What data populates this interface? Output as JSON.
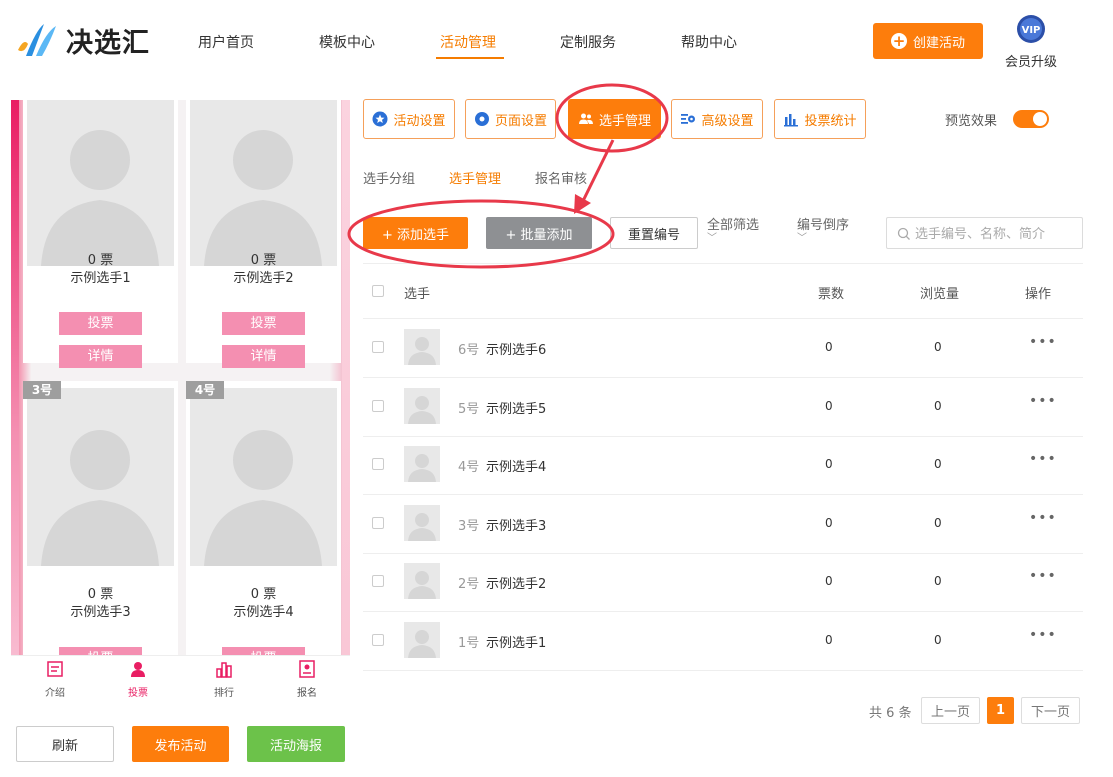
{
  "header": {
    "logo_text": "决选汇",
    "nav": [
      "用户首页",
      "模板中心",
      "活动管理",
      "定制服务",
      "帮助中心"
    ],
    "active_nav": "活动管理",
    "create_label": "创建活动",
    "vip_badge": "VIP",
    "vip_label": "会员升级"
  },
  "preview": {
    "cards": [
      {
        "number": "",
        "votes": "0 票",
        "name": "示例选手1",
        "vote_label": "投票",
        "detail_label": "详情"
      },
      {
        "number": "",
        "votes": "0 票",
        "name": "示例选手2",
        "vote_label": "投票",
        "detail_label": "详情"
      },
      {
        "number": "3号",
        "votes": "0 票",
        "name": "示例选手3",
        "vote_label": "投票"
      },
      {
        "number": "4号",
        "votes": "0 票",
        "name": "示例选手4",
        "vote_label": "投票"
      }
    ],
    "tabbar": [
      {
        "label": "介绍",
        "icon": "intro-icon"
      },
      {
        "label": "投票",
        "icon": "user-icon"
      },
      {
        "label": "排行",
        "icon": "ranking-icon"
      },
      {
        "label": "报名",
        "icon": "signup-icon"
      }
    ],
    "active_tab": "投票"
  },
  "bottom_buttons": {
    "refresh": "刷新",
    "publish": "发布活动",
    "poster": "活动海报"
  },
  "settings_tabs": [
    {
      "label": "活动设置",
      "icon": "star-icon"
    },
    {
      "label": "页面设置",
      "icon": "gear-icon"
    },
    {
      "label": "选手管理",
      "icon": "users-icon"
    },
    {
      "label": "高级设置",
      "icon": "advanced-settings-icon"
    },
    {
      "label": "投票统计",
      "icon": "bar-chart-icon"
    }
  ],
  "active_settings_tab": "选手管理",
  "preview_toggle": {
    "label": "预览效果",
    "on": true
  },
  "sub_tabs": [
    "选手分组",
    "选手管理",
    "报名审核"
  ],
  "active_sub_tab": "选手管理",
  "actions": {
    "add": "+ 添加选手",
    "batch_add": "+ 批量添加",
    "renumber": "重置编号",
    "filter_all": "全部筛选",
    "sort_number": "编号倒序",
    "search_placeholder": "选手编号、名称、简介"
  },
  "table": {
    "headers": {
      "player": "选手",
      "votes": "票数",
      "views": "浏览量",
      "actions": "操作"
    },
    "rows": [
      {
        "number": "6号",
        "name": "示例选手6",
        "votes": "0",
        "views": "0",
        "more": "•••"
      },
      {
        "number": "5号",
        "name": "示例选手5",
        "votes": "0",
        "views": "0",
        "more": "•••"
      },
      {
        "number": "4号",
        "name": "示例选手4",
        "votes": "0",
        "views": "0",
        "more": "•••"
      },
      {
        "number": "3号",
        "name": "示例选手3",
        "votes": "0",
        "views": "0",
        "more": "•••"
      },
      {
        "number": "2号",
        "name": "示例选手2",
        "votes": "0",
        "views": "0",
        "more": "•••"
      },
      {
        "number": "1号",
        "name": "示例选手1",
        "votes": "0",
        "views": "0",
        "more": "•••"
      }
    ]
  },
  "pagination": {
    "total": "共 6 条",
    "prev": "上一页",
    "current": "1",
    "next": "下一页"
  },
  "colors": {
    "accent": "#fd7d0c",
    "pink": "#f48fb1",
    "green": "#6cc24a",
    "gray_button": "#8e9093",
    "annotation": "#e8394a"
  }
}
